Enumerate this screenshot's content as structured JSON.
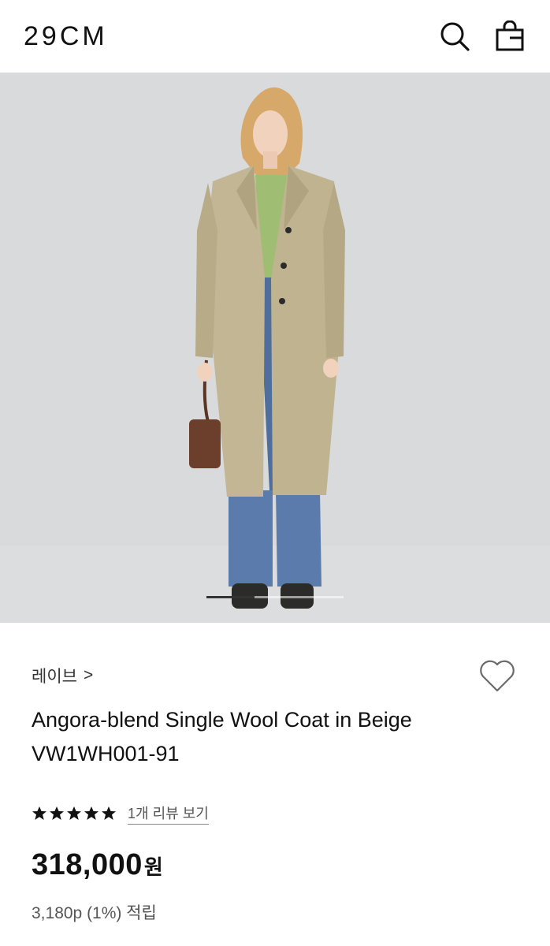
{
  "header": {
    "logo": "29CM",
    "search_icon": "search-icon",
    "bag_icon": "shopping-bag-icon"
  },
  "hero": {
    "image_alt": "",
    "slide_progress": 0.35
  },
  "product": {
    "brand": "레이브",
    "brand_chevron": ">",
    "title": "Angora-blend Single Wool Coat in Beige VW1WH001-91",
    "rating_stars": 5,
    "review_link": "1개 리뷰 보기",
    "price": "318,000",
    "price_unit": "원",
    "points": "3,180p (1%) 적립"
  },
  "colors": {
    "background": "#ffffff",
    "photo_bg": "#d9dadc",
    "coat": "#c2b694",
    "text": "#111111"
  }
}
